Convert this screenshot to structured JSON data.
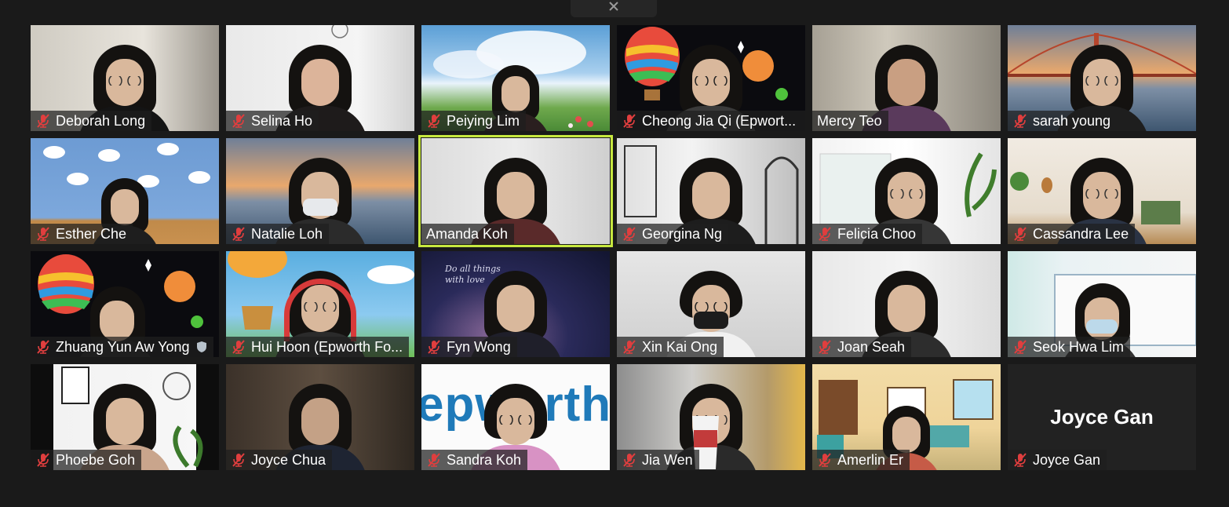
{
  "tiles": [
    {
      "name": "Deborah Long",
      "muted": true
    },
    {
      "name": "Selina Ho",
      "muted": true
    },
    {
      "name": "Peiying Lim",
      "muted": true
    },
    {
      "name": "Cheong Jia Qi (Epwort...",
      "muted": true,
      "shield": true
    },
    {
      "name": "Mercy Teo",
      "muted": false
    },
    {
      "name": "sarah young",
      "muted": true
    },
    {
      "name": "Esther Che",
      "muted": true
    },
    {
      "name": "Natalie Loh",
      "muted": true
    },
    {
      "name": "Amanda Koh",
      "muted": false,
      "active": true
    },
    {
      "name": "Georgina Ng",
      "muted": true
    },
    {
      "name": "Felicia Choo",
      "muted": true
    },
    {
      "name": "Cassandra Lee",
      "muted": true
    },
    {
      "name": "Zhuang Yun Aw Yong",
      "muted": true,
      "shield": true
    },
    {
      "name": "Hui Hoon (Epworth Fo...",
      "muted": true
    },
    {
      "name": "Fyn Wong",
      "muted": true
    },
    {
      "name": "Xin Kai Ong",
      "muted": true
    },
    {
      "name": "Joan Seah",
      "muted": true
    },
    {
      "name": "Seok Hwa Lim",
      "muted": true
    },
    {
      "name": "Phoebe Goh",
      "muted": true
    },
    {
      "name": "Joyce Chua",
      "muted": true
    },
    {
      "name": "Sandra Koh",
      "muted": true
    },
    {
      "name": "Jia Wen",
      "muted": true
    },
    {
      "name": "Amerlin Er",
      "muted": true
    },
    {
      "name": "Joyce Gan",
      "muted": true,
      "video_off": true,
      "big_name": "Joyce Gan"
    }
  ],
  "overlay_text": {
    "fyn_wong_bg": "Do all things with love",
    "sandra_koh_bg": "epworth"
  },
  "colors": {
    "active_speaker_border": "#c7e83f",
    "muted_icon": "#e03e3e",
    "background": "#1a1a1a"
  }
}
